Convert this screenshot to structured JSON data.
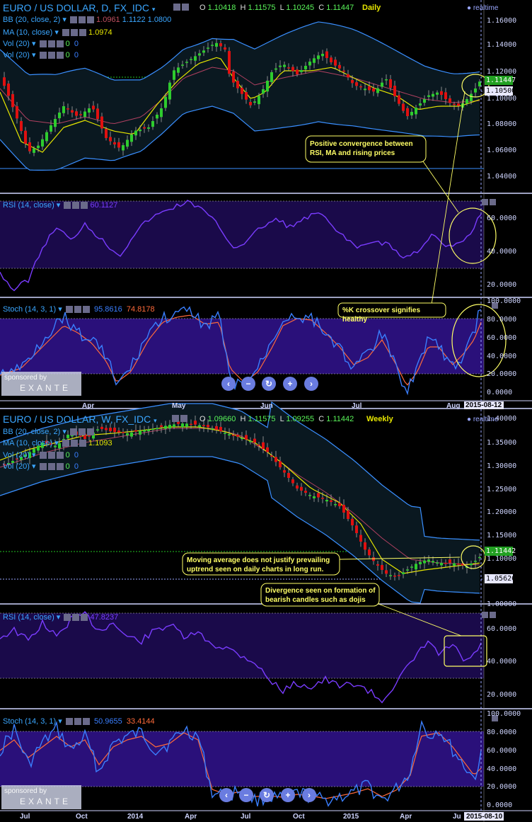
{
  "daily": {
    "symbol": "EURO / US DOLLAR, D, FX_IDC",
    "ohlc": {
      "o_label": "O",
      "o": "1.10418",
      "h_label": "H",
      "h": "1.11575",
      "l_label": "L",
      "l": "1.10245",
      "c_label": "C",
      "c": "1.11447"
    },
    "period": "Daily",
    "realtime": "realtime",
    "bb": {
      "label": "BB (20, close, 2)",
      "v1": "1.0961",
      "v2": "1.1122",
      "v3": "1.0800"
    },
    "ma": {
      "label": "MA (10, close)",
      "value": "1.0974"
    },
    "vol1": {
      "label": "Vol (20)",
      "v1": "0",
      "v2": "0"
    },
    "vol2": {
      "label": "Vol (20)",
      "v1": "0",
      "v2": "0"
    },
    "price_axis": [
      "1.16000",
      "1.14000",
      "1.12000",
      "1.10000",
      "1.08000",
      "1.06000",
      "1.04000"
    ],
    "price_tag_last": "1.11447",
    "price_tag_mid": "1.10500",
    "rsi": {
      "label": "RSI (14, close)",
      "value": "60.1127",
      "axis": [
        "60.0000",
        "40.0000",
        "20.0000"
      ]
    },
    "stoch": {
      "label": "Stoch (14, 3, 1)",
      "k": "95.8616",
      "d": "74.8178",
      "axis": [
        "100.0000",
        "80.0000",
        "60.0000",
        "40.0000",
        "20.0000",
        "0.0000"
      ]
    },
    "x_labels": [
      "Apr",
      "May",
      "Jun",
      "Jul",
      "Aug"
    ],
    "x_date": "2015-08-12",
    "annotations": {
      "a1": "Positive convergence between RSI, MA and rising prices",
      "a2": "%K crossover signifies healthy"
    }
  },
  "weekly": {
    "symbol": "EURO / US DOLLAR, W, FX_IDC",
    "ohlc": {
      "o_label": "O",
      "o": "1.09660",
      "h_label": "H",
      "h": "1.11575",
      "l_label": "L",
      "l": "1.09255",
      "c_label": "C",
      "c": "1.11442"
    },
    "period": "Weekly",
    "realtime": "realtime",
    "bb": {
      "label": "BB (20, close, 2)"
    },
    "ma": {
      "label": "MA (10, close)",
      "value": "1.1093"
    },
    "vol1": {
      "label": "Vol (20)",
      "v1": "0",
      "v2": "0"
    },
    "vol2": {
      "label": "Vol (20)",
      "v1": "0",
      "v2": "0"
    },
    "price_axis": [
      "1.40000",
      "1.35000",
      "1.30000",
      "1.25000",
      "1.20000",
      "1.15000",
      "1.10000",
      "1.00000"
    ],
    "price_tag_last": "1.11442",
    "price_tag_low": "1.05626",
    "rsi": {
      "label": "RSI (14, close)",
      "value": "47.8237",
      "axis": [
        "60.0000",
        "40.0000",
        "20.0000"
      ]
    },
    "stoch": {
      "label": "Stoch (14, 3, 1)",
      "k": "50.9655",
      "d": "33.4144",
      "axis": [
        "100.0000",
        "80.0000",
        "60.0000",
        "40.0000",
        "20.0000",
        "0.0000"
      ]
    },
    "x_labels": [
      "Jul",
      "Oct",
      "2014",
      "Apr",
      "Jul",
      "Oct",
      "2015",
      "Apr",
      "Ju"
    ],
    "x_date": "2015-08-10",
    "annotations": {
      "a1": "Moving average   does not justify prevailing uptrend seen on daily charts in long run.",
      "a2": "Divergence seen on formation of bearish candles such as dojis"
    }
  },
  "watermark": {
    "line1": "sponsored by",
    "line2": "EXANTE"
  },
  "colors": {
    "bull": "#2ecc2e",
    "bear": "#e01010",
    "bb": "#3a8fff",
    "ma": "#e6e600",
    "bbmid": "#c05060",
    "rsi": "#7a3cff",
    "stochK": "#3a7fff",
    "stochD": "#ff6a3a",
    "band": "#2a107a",
    "annot": "#ffff66"
  },
  "chart_data": [
    {
      "type": "line",
      "title": "EURO / US DOLLAR, D, FX_IDC",
      "x_ticks": [
        "Apr",
        "May",
        "Jun",
        "Jul",
        "Aug"
      ],
      "ylim": [
        1.04,
        1.16
      ],
      "series": [
        {
          "name": "MA (10, close)",
          "values": [
            1.06,
            1.09,
            1.11,
            1.12,
            1.09,
            1.11,
            1.12,
            1.13,
            1.11,
            1.1,
            1.09,
            1.0974
          ]
        }
      ]
    },
    {
      "type": "line",
      "title": "EURO / US DOLLAR, W, FX_IDC",
      "x_ticks": [
        "Jul",
        "Oct",
        "2014",
        "Apr",
        "Jul",
        "Oct",
        "2015",
        "Apr",
        "Ju"
      ],
      "ylim": [
        1.0,
        1.4
      ],
      "series": [
        {
          "name": "MA (10, close)",
          "values": [
            1.31,
            1.33,
            1.36,
            1.38,
            1.37,
            1.32,
            1.26,
            1.19,
            1.12,
            1.09,
            1.1,
            1.1093
          ]
        }
      ]
    }
  ]
}
